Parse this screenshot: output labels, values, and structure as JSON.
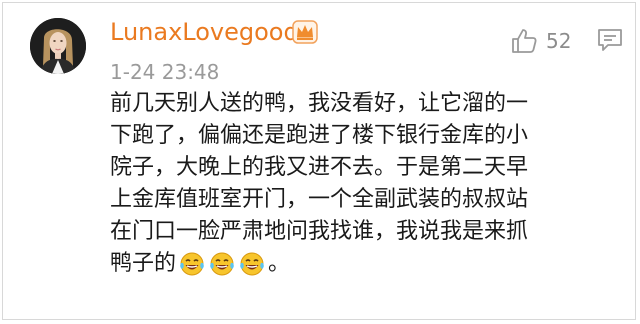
{
  "comment": {
    "username": "LunaxLovegood",
    "timestamp": "1-24 23:48",
    "like_count": "52",
    "body_lines": [
      "前几天别人送的鸭，我没看好，让它溜的一",
      "下跑了，偏偏还是跑进了楼下银行金库的小",
      "院子，大晚上的我又进不去。于是第二天早",
      "上金库值班室开门，一个全副武装的叔叔站",
      "在门口一脸严肃地问我找谁，我说我是来抓",
      "鸭子的"
    ],
    "trailing_text": "。",
    "emoji_count": 3,
    "emoji_name": "laugh-cry-emoji",
    "badge_icon": "crown-badge-icon",
    "like_icon": "thumbs-up-icon",
    "comment_icon": "comment-icon"
  },
  "colors": {
    "username": "#ea7a20",
    "timestamp": "#9a9a9a",
    "body_text": "#1a1a1a",
    "icon_gray": "#9a9a9a"
  }
}
